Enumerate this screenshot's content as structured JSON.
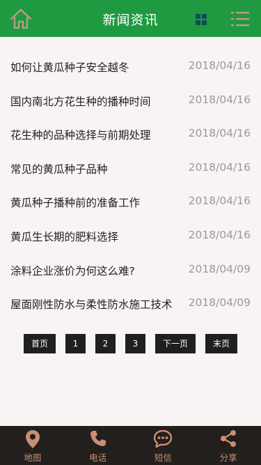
{
  "header": {
    "title": "新闻资讯",
    "home_icon": "home-icon",
    "grid_icon": "grid-icon",
    "menu_icon": "list-menu-icon",
    "accent": "#1f9a40",
    "icon_color": "#c09a85"
  },
  "news": [
    {
      "title": "如何让黄瓜种子安全越冬",
      "date": "2018/04/16"
    },
    {
      "title": "国内南北方花生种的播种时间",
      "date": "2018/04/16"
    },
    {
      "title": "花生种的品种选择与前期处理",
      "date": "2018/04/16"
    },
    {
      "title": "常见的黄瓜种子品种",
      "date": "2018/04/16"
    },
    {
      "title": "黄瓜种子播种前的准备工作",
      "date": "2018/04/16"
    },
    {
      "title": "黄瓜生长期的肥料选择",
      "date": "2018/04/16"
    },
    {
      "title": "涂料企业涨价为何这么难?",
      "date": "2018/04/09"
    },
    {
      "title": "屋面刚性防水与柔性防水施工技术",
      "date": "2018/04/09"
    }
  ],
  "pagination": {
    "first": "首页",
    "pages": [
      "1",
      "2",
      "3"
    ],
    "next": "下一页",
    "last": "末页"
  },
  "footer": {
    "items": [
      {
        "label": "地图",
        "icon": "map-pin-icon"
      },
      {
        "label": "电话",
        "icon": "phone-icon"
      },
      {
        "label": "短信",
        "icon": "sms-icon"
      },
      {
        "label": "分享",
        "icon": "share-icon"
      }
    ],
    "background": "#221f1c",
    "icon_color": "#c98d72"
  }
}
